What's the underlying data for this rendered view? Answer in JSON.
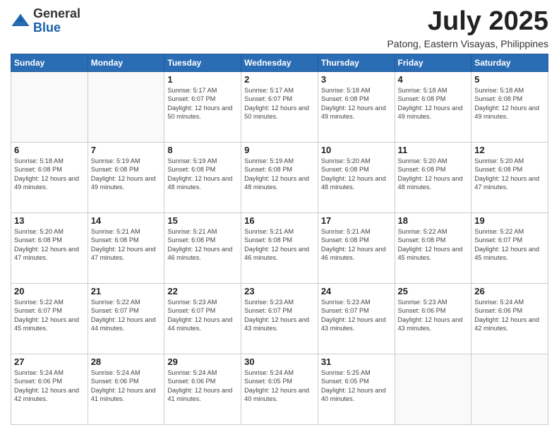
{
  "logo": {
    "general": "General",
    "blue": "Blue"
  },
  "title": "July 2025",
  "subtitle": "Patong, Eastern Visayas, Philippines",
  "days_of_week": [
    "Sunday",
    "Monday",
    "Tuesday",
    "Wednesday",
    "Thursday",
    "Friday",
    "Saturday"
  ],
  "weeks": [
    [
      {
        "day": "",
        "info": ""
      },
      {
        "day": "",
        "info": ""
      },
      {
        "day": "1",
        "info": "Sunrise: 5:17 AM\nSunset: 6:07 PM\nDaylight: 12 hours and 50 minutes."
      },
      {
        "day": "2",
        "info": "Sunrise: 5:17 AM\nSunset: 6:07 PM\nDaylight: 12 hours and 50 minutes."
      },
      {
        "day": "3",
        "info": "Sunrise: 5:18 AM\nSunset: 6:08 PM\nDaylight: 12 hours and 49 minutes."
      },
      {
        "day": "4",
        "info": "Sunrise: 5:18 AM\nSunset: 6:08 PM\nDaylight: 12 hours and 49 minutes."
      },
      {
        "day": "5",
        "info": "Sunrise: 5:18 AM\nSunset: 6:08 PM\nDaylight: 12 hours and 49 minutes."
      }
    ],
    [
      {
        "day": "6",
        "info": "Sunrise: 5:18 AM\nSunset: 6:08 PM\nDaylight: 12 hours and 49 minutes."
      },
      {
        "day": "7",
        "info": "Sunrise: 5:19 AM\nSunset: 6:08 PM\nDaylight: 12 hours and 49 minutes."
      },
      {
        "day": "8",
        "info": "Sunrise: 5:19 AM\nSunset: 6:08 PM\nDaylight: 12 hours and 48 minutes."
      },
      {
        "day": "9",
        "info": "Sunrise: 5:19 AM\nSunset: 6:08 PM\nDaylight: 12 hours and 48 minutes."
      },
      {
        "day": "10",
        "info": "Sunrise: 5:20 AM\nSunset: 6:08 PM\nDaylight: 12 hours and 48 minutes."
      },
      {
        "day": "11",
        "info": "Sunrise: 5:20 AM\nSunset: 6:08 PM\nDaylight: 12 hours and 48 minutes."
      },
      {
        "day": "12",
        "info": "Sunrise: 5:20 AM\nSunset: 6:08 PM\nDaylight: 12 hours and 47 minutes."
      }
    ],
    [
      {
        "day": "13",
        "info": "Sunrise: 5:20 AM\nSunset: 6:08 PM\nDaylight: 12 hours and 47 minutes."
      },
      {
        "day": "14",
        "info": "Sunrise: 5:21 AM\nSunset: 6:08 PM\nDaylight: 12 hours and 47 minutes."
      },
      {
        "day": "15",
        "info": "Sunrise: 5:21 AM\nSunset: 6:08 PM\nDaylight: 12 hours and 46 minutes."
      },
      {
        "day": "16",
        "info": "Sunrise: 5:21 AM\nSunset: 6:08 PM\nDaylight: 12 hours and 46 minutes."
      },
      {
        "day": "17",
        "info": "Sunrise: 5:21 AM\nSunset: 6:08 PM\nDaylight: 12 hours and 46 minutes."
      },
      {
        "day": "18",
        "info": "Sunrise: 5:22 AM\nSunset: 6:08 PM\nDaylight: 12 hours and 45 minutes."
      },
      {
        "day": "19",
        "info": "Sunrise: 5:22 AM\nSunset: 6:07 PM\nDaylight: 12 hours and 45 minutes."
      }
    ],
    [
      {
        "day": "20",
        "info": "Sunrise: 5:22 AM\nSunset: 6:07 PM\nDaylight: 12 hours and 45 minutes."
      },
      {
        "day": "21",
        "info": "Sunrise: 5:22 AM\nSunset: 6:07 PM\nDaylight: 12 hours and 44 minutes."
      },
      {
        "day": "22",
        "info": "Sunrise: 5:23 AM\nSunset: 6:07 PM\nDaylight: 12 hours and 44 minutes."
      },
      {
        "day": "23",
        "info": "Sunrise: 5:23 AM\nSunset: 6:07 PM\nDaylight: 12 hours and 43 minutes."
      },
      {
        "day": "24",
        "info": "Sunrise: 5:23 AM\nSunset: 6:07 PM\nDaylight: 12 hours and 43 minutes."
      },
      {
        "day": "25",
        "info": "Sunrise: 5:23 AM\nSunset: 6:06 PM\nDaylight: 12 hours and 43 minutes."
      },
      {
        "day": "26",
        "info": "Sunrise: 5:24 AM\nSunset: 6:06 PM\nDaylight: 12 hours and 42 minutes."
      }
    ],
    [
      {
        "day": "27",
        "info": "Sunrise: 5:24 AM\nSunset: 6:06 PM\nDaylight: 12 hours and 42 minutes."
      },
      {
        "day": "28",
        "info": "Sunrise: 5:24 AM\nSunset: 6:06 PM\nDaylight: 12 hours and 41 minutes."
      },
      {
        "day": "29",
        "info": "Sunrise: 5:24 AM\nSunset: 6:06 PM\nDaylight: 12 hours and 41 minutes."
      },
      {
        "day": "30",
        "info": "Sunrise: 5:24 AM\nSunset: 6:05 PM\nDaylight: 12 hours and 40 minutes."
      },
      {
        "day": "31",
        "info": "Sunrise: 5:25 AM\nSunset: 6:05 PM\nDaylight: 12 hours and 40 minutes."
      },
      {
        "day": "",
        "info": ""
      },
      {
        "day": "",
        "info": ""
      }
    ]
  ]
}
